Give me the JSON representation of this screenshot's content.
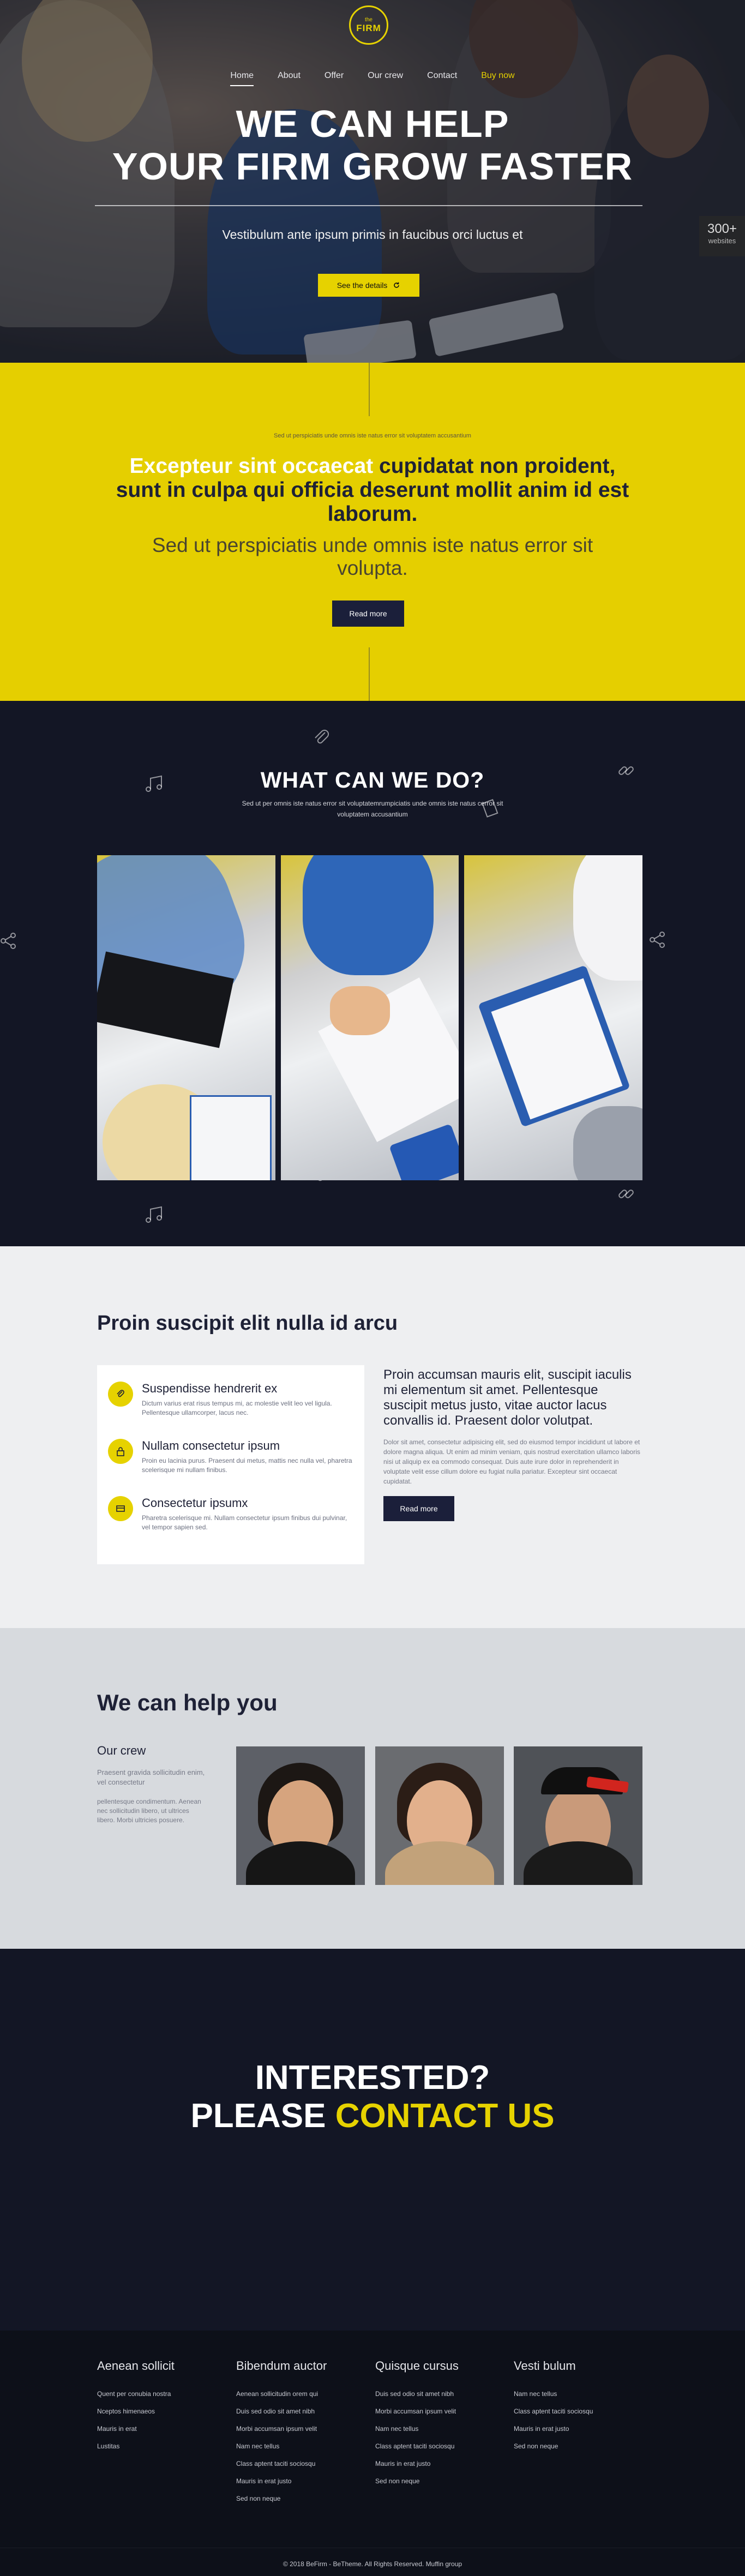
{
  "brand": {
    "the": "the",
    "name": "FIRM"
  },
  "nav": {
    "items": [
      "Home",
      "About",
      "Offer",
      "Our crew",
      "Contact"
    ],
    "buy": "Buy now"
  },
  "hero": {
    "title_line1": "WE CAN HELP",
    "title_line2": "YOUR FIRM GROW FASTER",
    "subtitle": "Vestibulum ante ipsum primis in faucibus orci luctus et",
    "button": "See the details",
    "badge_number": "300+",
    "badge_label": "websites"
  },
  "intro": {
    "small": "Sed ut perspiciatis unde omnis iste natus error sit voluptatem accusantium",
    "head_white": "Excepteur sint occaecat",
    "head_dark": "cupidatat non proident, sunt in culpa qui officia deserunt mollit anim id est laborum.",
    "body": "Sed ut perspiciatis unde omnis iste natus error sit volupta.",
    "button": "Read more"
  },
  "services": {
    "title": "WHAT CAN WE DO?",
    "desc": "Sed ut per omnis iste natus error sit voluptatemrumpiciatis unde omnis iste natus cerror sit voluptatem accusantium"
  },
  "proin": {
    "title": "Proin suscipit elit nulla id arcu",
    "features": [
      {
        "title": "Suspendisse hendrerit ex",
        "desc": "Dictum varius erat risus tempus mi, ac molestie velit leo vel ligula. Pellentesque ullamcorper, lacus nec."
      },
      {
        "title": "Nullam consectetur ipsum",
        "desc": "Proin eu lacinia purus. Praesent dui metus, mattis nec nulla vel, pharetra scelerisque mi nullam finibus."
      },
      {
        "title": "Consectetur ipsumx",
        "desc": "Pharetra scelerisque mi. Nullam consectetur ipsum finibus dui pulvinar, vel tempor sapien sed."
      }
    ],
    "lead": "Proin accumsan mauris elit, suscipit iaculis mi elementum sit amet. Pellentesque suscipit metus justo, vitae auctor lacus convallis id. Praesent dolor volutpat.",
    "body": "Dolor sit amet, consectetur adipisicing elit, sed do eiusmod tempor incididunt ut labore et dolore magna aliqua. Ut enim ad minim veniam, quis nostrud exercitation ullamco laboris nisi ut aliquip ex ea commodo consequat. Duis aute irure dolor in reprehenderit in voluptate velit esse cillum dolore eu fugiat nulla pariatur. Excepteur sint occaecat cupidatat.",
    "button": "Read more"
  },
  "help": {
    "title": "We can help you",
    "crew_title": "Our crew",
    "crew_text1": "Praesent gravida sollicitudin enim, vel consectetur",
    "crew_text2": "pellentesque condimentum. Aenean nec sollicitudin libero, ut ultrices libero. Morbi ultricies posuere."
  },
  "cta": {
    "line1": "INTERESTED?",
    "line2_white": "PLEASE",
    "line2_yellow": "CONTACT US"
  },
  "footer": {
    "columns": [
      {
        "title": "Aenean sollicit",
        "items": [
          "Quent per conubia nostra",
          "Nceptos himenaeos",
          "Mauris in erat",
          "Lustitas"
        ]
      },
      {
        "title": "Bibendum auctor",
        "items": [
          "Aenean sollicitudin orem qui",
          "Duis sed odio sit amet nibh",
          "Morbi accumsan ipsum velit",
          "Nam nec tellus",
          "Class aptent taciti sociosqu",
          "Mauris in erat justo",
          "Sed non neque"
        ]
      },
      {
        "title": "Quisque cursus",
        "items": [
          "Duis sed odio sit amet nibh",
          "Morbi accumsan ipsum velit",
          "Nam nec tellus",
          "Class aptent taciti sociosqu",
          "Mauris in erat justo",
          "Sed non neque"
        ]
      },
      {
        "title": "Vesti bulum",
        "items": [
          "Nam nec tellus",
          "Class aptent taciti sociosqu",
          "Mauris in erat justo",
          "Sed non neque"
        ]
      }
    ],
    "copyright": "© 2018 BeFirm - BeTheme. All Rights Reserved.",
    "credit": "Muffin group"
  }
}
